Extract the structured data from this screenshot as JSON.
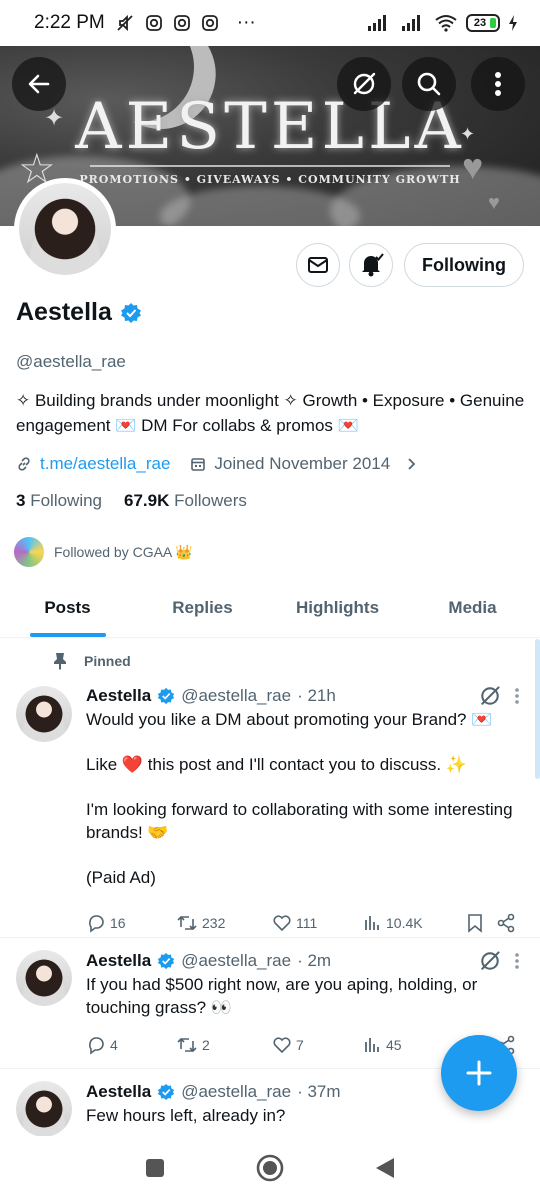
{
  "status_bar": {
    "time": "2:22 PM",
    "dots": "···",
    "battery": "23"
  },
  "banner": {
    "title": "AESTELLA",
    "subtitle": "PROMOTIONS • GIVEAWAYS • COMMUNITY GROWTH"
  },
  "header_buttons": {
    "back": "back-arrow-icon",
    "grok": "grok-icon",
    "search": "search-icon",
    "more": "more-vertical-icon"
  },
  "profile": {
    "following_button": "Following",
    "name": "Aestella",
    "handle": "@aestella_rae",
    "bio": "✧ Building brands under moonlight ✧ Growth • Exposure • Genuine engagement 💌 DM For collabs & promos 💌",
    "link": "t.me/aestella_rae",
    "joined": "Joined November 2014",
    "following_count": "3",
    "following_label": "Following",
    "followers_count": "67.9K",
    "followers_label": "Followers",
    "followed_by": "Followed by CGAA 👑"
  },
  "tabs": [
    "Posts",
    "Replies",
    "Highlights",
    "Media"
  ],
  "pinned_label": "Pinned",
  "posts": [
    {
      "name": "Aestella",
      "handle": "@aestella_rae",
      "time": "· 21h",
      "body": "Would you like a DM about promoting your Brand? 💌\n\nLike ❤️ this post and I'll contact you to discuss. ✨\n\nI'm looking forward to collaborating with some interesting brands! 🤝\n\n(Paid Ad)",
      "replies": "16",
      "reposts": "232",
      "likes": "111",
      "views": "10.4K"
    },
    {
      "name": "Aestella",
      "handle": "@aestella_rae",
      "time": "· 2m",
      "body": "If you had $500 right now, are you aping, holding, or touching grass? 👀",
      "replies": "4",
      "reposts": "2",
      "likes": "7",
      "views": "45"
    },
    {
      "name": "Aestella",
      "handle": "@aestella_rae",
      "time": "· 37m",
      "body": "Few hours left, already in?"
    }
  ],
  "colors": {
    "accent": "#1d9bf0",
    "text": "#0f1419",
    "secondary": "#536471"
  }
}
